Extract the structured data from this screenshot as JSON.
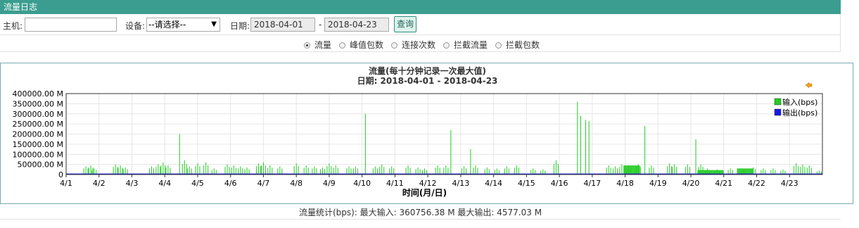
{
  "page_title": "流量日志",
  "filters": {
    "host_label": "主机:",
    "host_value": "",
    "device_label": "设备:",
    "device_value": "--请选择--",
    "date_label": "日期:",
    "date_from": "2018-04-01",
    "date_sep": "-",
    "date_to": "2018-04-23",
    "query_label": "查询"
  },
  "metrics": [
    {
      "label": "流量",
      "selected": true
    },
    {
      "label": "峰值包数",
      "selected": false
    },
    {
      "label": "连接次数",
      "selected": false
    },
    {
      "label": "拦截流量",
      "selected": false
    },
    {
      "label": "拦截包数",
      "selected": false
    }
  ],
  "chart_data": {
    "type": "area",
    "title": "流量(每十分钟记录一次最大值)",
    "subtitle": "日期: 2018-04-01 - 2018-04-23",
    "xlabel": "时间(月/日)",
    "ylabel": "",
    "ylim": [
      0,
      400000
    ],
    "y_ticks": [
      0,
      50000,
      100000,
      150000,
      200000,
      250000,
      300000,
      350000,
      400000
    ],
    "y_tick_labels": [
      "0",
      "50000.00 M",
      "100000.00 M",
      "150000.00 M",
      "200000.00 M",
      "250000.00 M",
      "300000.00 M",
      "350000.00 M",
      "400000.00 M"
    ],
    "x_tick_labels": [
      "4/1",
      "4/2",
      "4/3",
      "4/4",
      "4/5",
      "4/6",
      "4/7",
      "4/8",
      "4/9",
      "4/10",
      "4/11",
      "4/12",
      "4/13",
      "4/14",
      "4/15",
      "4/16",
      "4/17",
      "4/18",
      "4/19",
      "4/20",
      "4/21",
      "4/22",
      "4/23"
    ],
    "legend_position": "top-right",
    "grid": true,
    "series": [
      {
        "name": "输入(bps)",
        "color": "#22cc22",
        "points": [
          [
            0.6,
            40000
          ],
          [
            0.75,
            45000
          ],
          [
            0.85,
            30000
          ],
          [
            1.5,
            50000
          ],
          [
            1.65,
            45000
          ],
          [
            1.8,
            35000
          ],
          [
            2.6,
            40000
          ],
          [
            2.8,
            50000
          ],
          [
            2.95,
            60000
          ],
          [
            3.1,
            45000
          ],
          [
            3.45,
            200000
          ],
          [
            3.6,
            70000
          ],
          [
            3.75,
            40000
          ],
          [
            4.0,
            55000
          ],
          [
            4.25,
            60000
          ],
          [
            4.5,
            30000
          ],
          [
            4.9,
            50000
          ],
          [
            5.1,
            45000
          ],
          [
            5.3,
            40000
          ],
          [
            5.5,
            35000
          ],
          [
            5.85,
            55000
          ],
          [
            6.0,
            60000
          ],
          [
            6.2,
            45000
          ],
          [
            6.5,
            40000
          ],
          [
            7.0,
            55000
          ],
          [
            7.3,
            45000
          ],
          [
            7.55,
            40000
          ],
          [
            7.8,
            35000
          ],
          [
            8.0,
            55000
          ],
          [
            8.2,
            45000
          ],
          [
            8.6,
            40000
          ],
          [
            8.8,
            40000
          ],
          [
            9.1,
            300000
          ],
          [
            9.4,
            40000
          ],
          [
            9.6,
            50000
          ],
          [
            9.9,
            40000
          ],
          [
            10.4,
            45000
          ],
          [
            10.7,
            35000
          ],
          [
            10.9,
            30000
          ],
          [
            11.3,
            45000
          ],
          [
            11.55,
            45000
          ],
          [
            11.7,
            220000
          ],
          [
            12.1,
            40000
          ],
          [
            12.3,
            125000
          ],
          [
            12.45,
            45000
          ],
          [
            12.8,
            35000
          ],
          [
            13.1,
            30000
          ],
          [
            13.4,
            40000
          ],
          [
            13.7,
            45000
          ],
          [
            14.2,
            30000
          ],
          [
            14.5,
            25000
          ],
          [
            14.9,
            70000
          ],
          [
            15.55,
            360000
          ],
          [
            15.65,
            290000
          ],
          [
            15.8,
            270000
          ],
          [
            15.9,
            265000
          ],
          [
            16.5,
            45000
          ],
          [
            16.7,
            40000
          ],
          [
            16.9,
            50000
          ],
          [
            17.1,
            45000
          ],
          [
            17.4,
            50000
          ],
          [
            17.6,
            240000
          ],
          [
            17.8,
            45000
          ],
          [
            18.35,
            55000
          ],
          [
            18.5,
            50000
          ],
          [
            18.9,
            50000
          ],
          [
            19.15,
            175000
          ],
          [
            19.3,
            50000
          ],
          [
            19.5,
            30000
          ],
          [
            19.8,
            25000
          ],
          [
            20.2,
            30000
          ],
          [
            20.6,
            25000
          ],
          [
            20.9,
            35000
          ],
          [
            21.2,
            30000
          ],
          [
            21.5,
            30000
          ],
          [
            21.8,
            25000
          ],
          [
            22.2,
            55000
          ],
          [
            22.4,
            50000
          ],
          [
            22.6,
            45000
          ],
          [
            22.9,
            20000
          ]
        ],
        "bands": [
          [
            16.95,
            17.45,
            45000
          ],
          [
            19.2,
            20.0,
            22000
          ],
          [
            20.4,
            20.9,
            30000
          ]
        ]
      },
      {
        "name": "输出(bps)",
        "color": "#1a1ae0",
        "points": [
          [
            0,
            2000
          ],
          [
            23,
            2000
          ]
        ]
      }
    ]
  },
  "stats": {
    "text": "流量统计(bps): 最大输入: 360756.38 M     最大输出: 4577.03 M"
  }
}
